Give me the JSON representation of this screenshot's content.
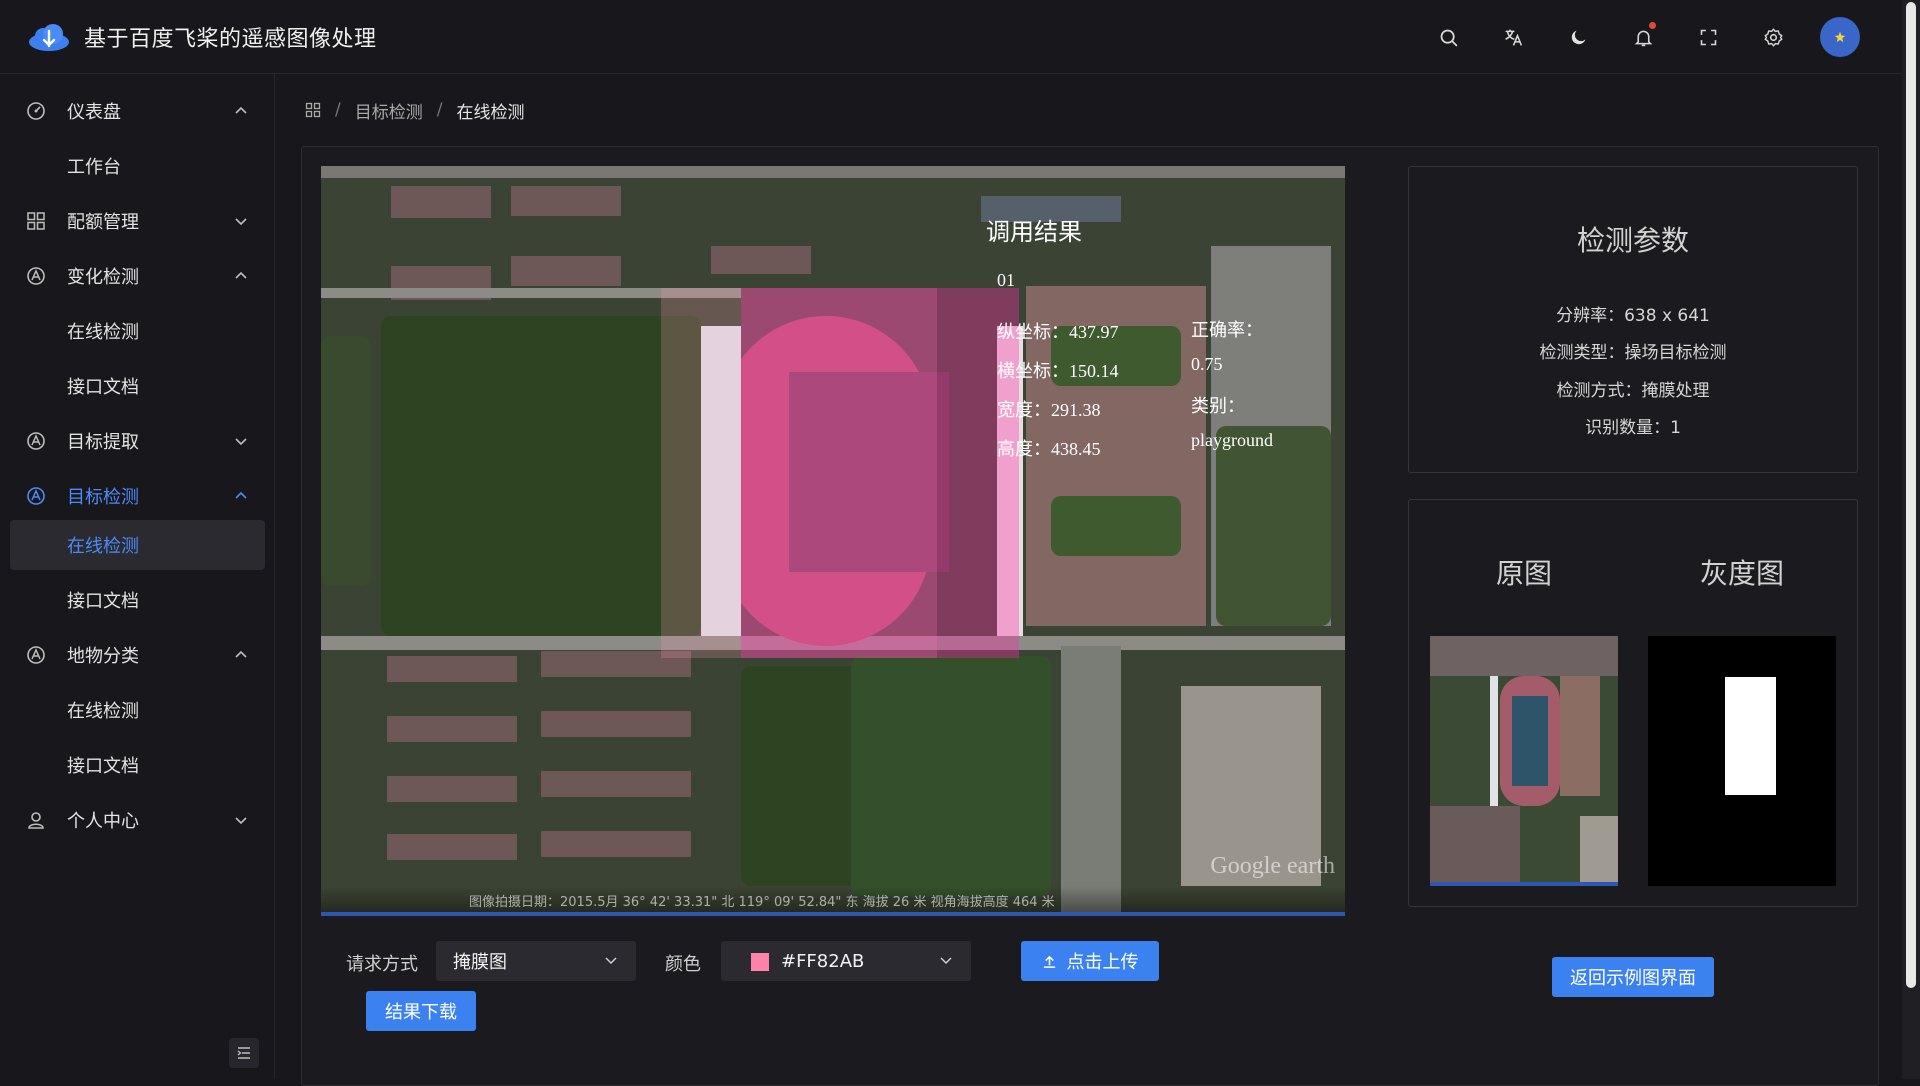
{
  "app": {
    "title": "基于百度飞桨的遥感图像处理",
    "accent_color": "#4B8BF5"
  },
  "header": {
    "icons": [
      "search-icon",
      "translate-icon",
      "moon-icon",
      "bell-icon",
      "fullscreen-icon",
      "settings-icon"
    ]
  },
  "sidebar": {
    "groups": [
      {
        "label": "仪表盘",
        "icon": "dashboard-icon",
        "expanded": true,
        "items": [
          "工作台"
        ]
      },
      {
        "label": "配额管理",
        "icon": "grid-icon",
        "expanded": false,
        "items": []
      },
      {
        "label": "变化检测",
        "icon": "detect-icon",
        "expanded": true,
        "items": [
          "在线检测",
          "接口文档"
        ]
      },
      {
        "label": "目标提取",
        "icon": "detect-icon",
        "expanded": false,
        "items": []
      },
      {
        "label": "目标检测",
        "icon": "detect-icon",
        "expanded": true,
        "active": true,
        "items": [
          "在线检测",
          "接口文档"
        ]
      },
      {
        "label": "地物分类",
        "icon": "detect-icon",
        "expanded": true,
        "items": [
          "在线检测",
          "接口文档"
        ]
      },
      {
        "label": "个人中心",
        "icon": "user-icon",
        "expanded": false,
        "items": []
      }
    ],
    "active_item": "在线检测"
  },
  "breadcrumb": {
    "items": [
      "目标检测",
      "在线检测"
    ]
  },
  "result": {
    "title": "调用结果",
    "id": "01",
    "lines": [
      "纵坐标：437.97",
      "横坐标：150.14",
      "宽度：291.38",
      "高度：438.45"
    ],
    "accuracy_label": "正确率：",
    "accuracy_value": "0.75",
    "class_label": "类别：",
    "class_value": "playground",
    "image_footer": "图像拍摄日期：2015.5月   36° 42' 33.31\" 北 119° 09' 52.84\" 东 海拔   26 米   视角海拔高度   464 米",
    "watermark": "Google earth"
  },
  "params": {
    "title": "检测参数",
    "lines": [
      "分辨率：638 x 641",
      "检测类型：操场目标检测",
      "检测方式：掩膜处理",
      "识别数量：1"
    ]
  },
  "preview": {
    "original_label": "原图",
    "gray_label": "灰度图"
  },
  "controls": {
    "request_label": "请求方式",
    "request_value": "掩膜图",
    "color_label": "颜色",
    "color_value": "#FF82AB",
    "upload_label": "点击上传",
    "download_label": "结果下载",
    "back_label": "返回示例图界面"
  }
}
